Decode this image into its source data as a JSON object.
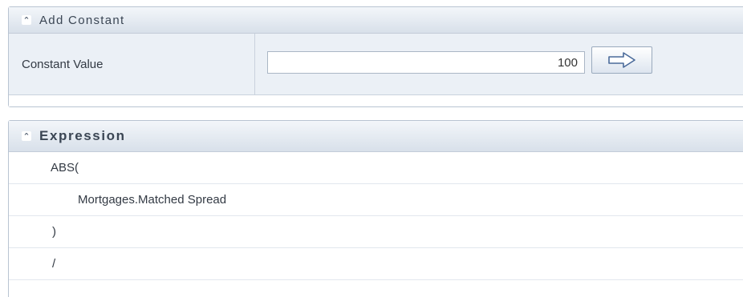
{
  "add_constant": {
    "collapse_icon": "double-chevron-up-icon",
    "title": "Add Constant",
    "label": "Constant Value",
    "value": "100",
    "apply_icon": "arrow-right-icon"
  },
  "expression": {
    "collapse_icon": "double-chevron-up-icon",
    "title": "Expression",
    "lines": [
      "ABS(",
      "Mortgages.Matched Spread",
      ")",
      "/"
    ]
  },
  "colors": {
    "header_gradient_top": "#f3f6fa",
    "header_gradient_bottom": "#d8e0ea",
    "row_background": "#ebf0f6",
    "border": "#b9c4d2"
  }
}
